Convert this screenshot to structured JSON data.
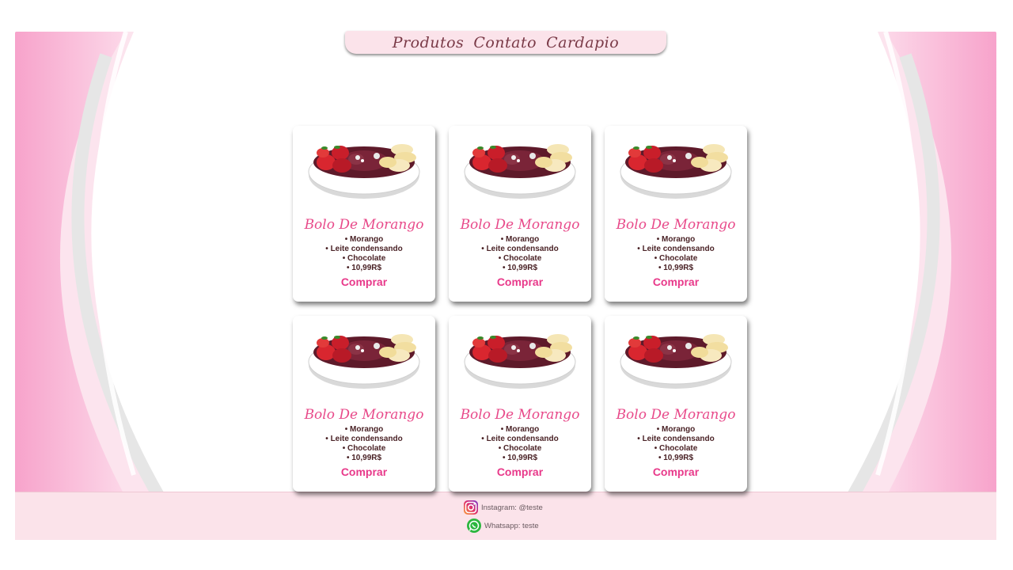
{
  "nav": {
    "items": [
      "Produtos",
      "Contato",
      "Cardapio"
    ]
  },
  "products": [
    {
      "title": "Bolo De Morango",
      "ingredients": [
        "Morango",
        "Leite condensando",
        "Chocolate"
      ],
      "price": "10,99R$",
      "buy_label": "Comprar"
    },
    {
      "title": "Bolo De Morango",
      "ingredients": [
        "Morango",
        "Leite condensando",
        "Chocolate"
      ],
      "price": "10,99R$",
      "buy_label": "Comprar"
    },
    {
      "title": "Bolo De Morango",
      "ingredients": [
        "Morango",
        "Leite condensando",
        "Chocolate"
      ],
      "price": "10,99R$",
      "buy_label": "Comprar"
    },
    {
      "title": "Bolo De Morango",
      "ingredients": [
        "Morango",
        "Leite condensando",
        "Chocolate"
      ],
      "price": "10,99R$",
      "buy_label": "Comprar"
    },
    {
      "title": "Bolo De Morango",
      "ingredients": [
        "Morango",
        "Leite condensando",
        "Chocolate"
      ],
      "price": "10,99R$",
      "buy_label": "Comprar"
    },
    {
      "title": "Bolo De Morango",
      "ingredients": [
        "Morango",
        "Leite condensando",
        "Chocolate"
      ],
      "price": "10,99R$",
      "buy_label": "Comprar"
    }
  ],
  "footer": {
    "instagram": {
      "label": "Instagram: @teste",
      "icon": "instagram-icon"
    },
    "whatsapp": {
      "label": "Whatsapp: teste",
      "icon": "whatsapp-icon"
    }
  },
  "colors": {
    "accent": "#e8398a",
    "title": "#e84a8a",
    "nav_bg": "#fbe3ea",
    "nav_text": "#7a3a47",
    "text_dark": "#4a2226"
  }
}
